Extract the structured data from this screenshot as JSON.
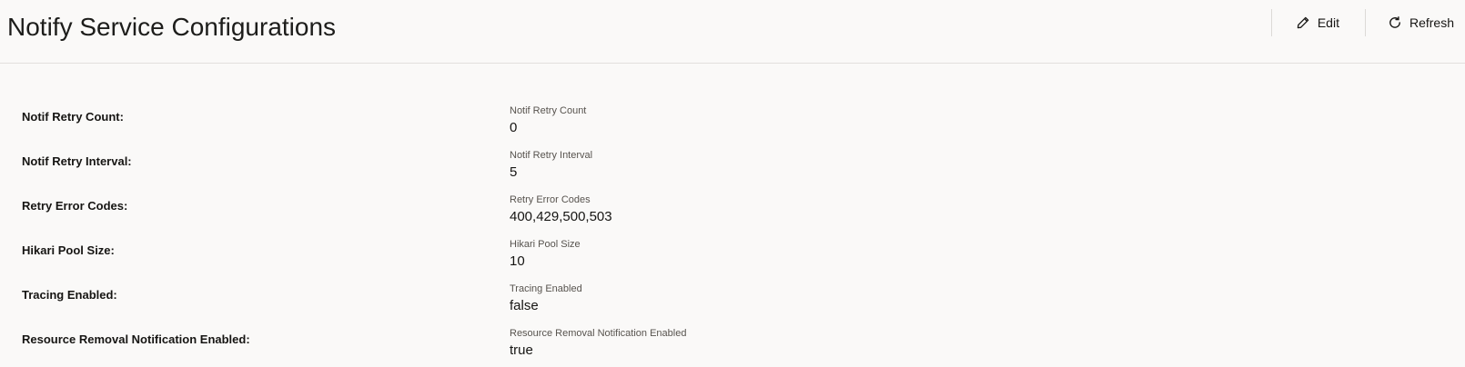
{
  "header": {
    "title": "Notify Service Configurations"
  },
  "toolbar": {
    "edit_label": "Edit",
    "refresh_label": "Refresh",
    "edit_icon": "pencil-icon",
    "refresh_icon": "refresh-icon"
  },
  "fields": [
    {
      "label": "Notif Retry Count:",
      "caption": "Notif Retry Count",
      "value": "0"
    },
    {
      "label": "Notif Retry Interval:",
      "caption": "Notif Retry Interval",
      "value": "5"
    },
    {
      "label": "Retry Error Codes:",
      "caption": "Retry Error Codes",
      "value": "400,429,500,503"
    },
    {
      "label": "Hikari Pool Size:",
      "caption": "Hikari Pool Size",
      "value": "10"
    },
    {
      "label": "Tracing Enabled:",
      "caption": "Tracing Enabled",
      "value": "false"
    },
    {
      "label": "Resource Removal Notification Enabled:",
      "caption": "Resource Removal Notification Enabled",
      "value": "true"
    }
  ]
}
